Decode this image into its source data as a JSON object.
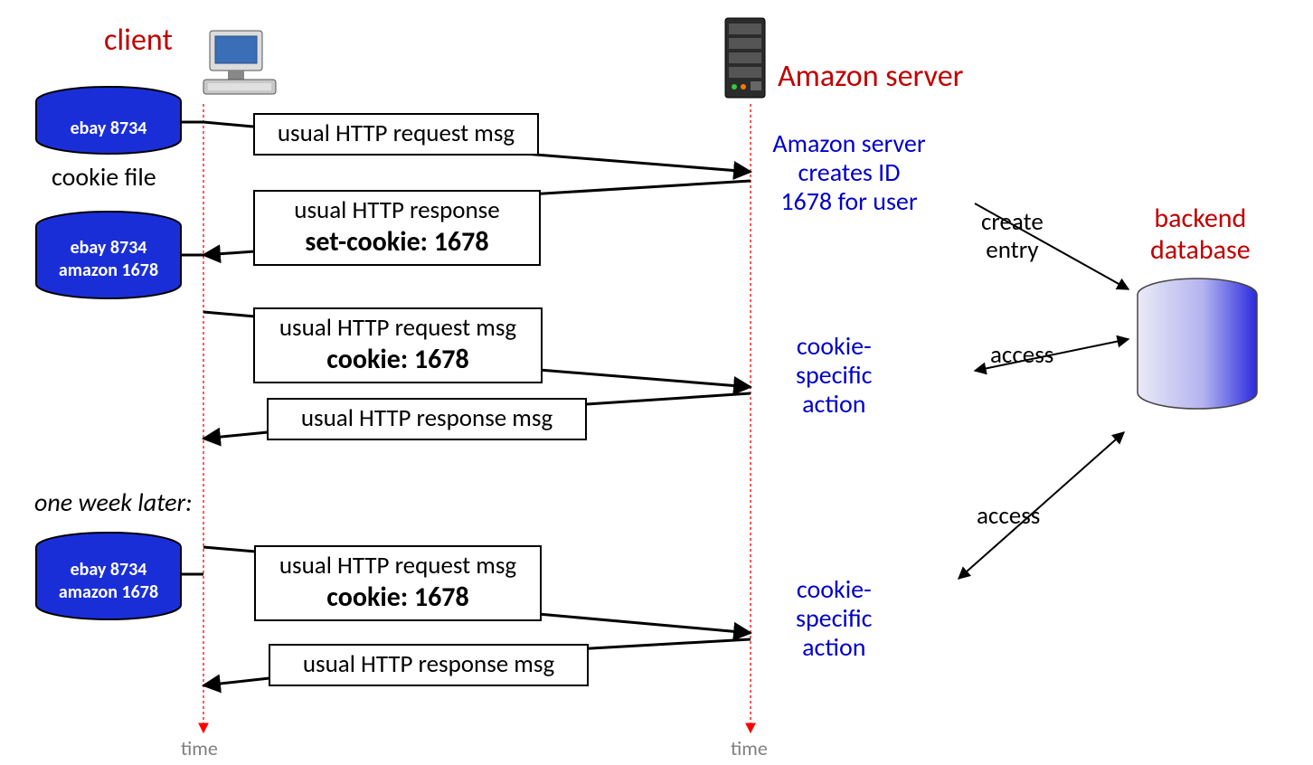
{
  "titles": {
    "client": "client",
    "server": "Amazon server",
    "backend": "backend\ndatabase"
  },
  "cookie_file_caption": "cookie file",
  "one_week_later": "one week later:",
  "cookies": {
    "c1": "ebay 8734",
    "c2a": "ebay 8734",
    "c2b": "amazon 1678",
    "c3a": "ebay 8734",
    "c3b": "amazon 1678"
  },
  "messages": {
    "m1": "usual HTTP request msg",
    "m2a": "usual HTTP response",
    "m2b": "set-cookie: 1678",
    "m3a": "usual HTTP request msg",
    "m3b": "cookie: 1678",
    "m4": "usual HTTP response msg",
    "m5a": "usual HTTP request msg",
    "m5b": "cookie: 1678",
    "m6": "usual HTTP response msg"
  },
  "server_notes": {
    "create_id": "Amazon server\ncreates ID\n1678 for user",
    "action1": "cookie-\nspecific\naction",
    "action2": "cookie-\nspecific\naction"
  },
  "db_labels": {
    "create_entry": "create\nentry",
    "access1": "access",
    "access2": "access"
  },
  "time_label": "time"
}
